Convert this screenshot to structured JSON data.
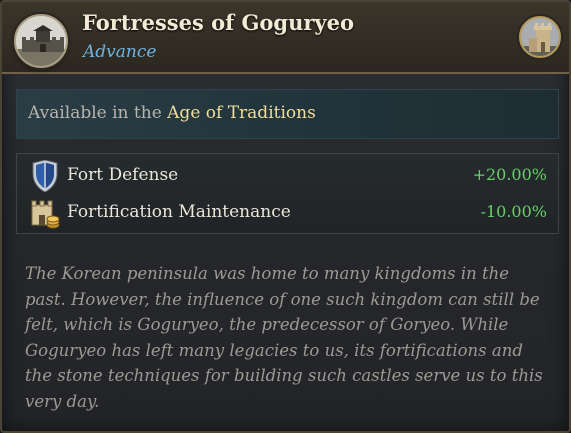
{
  "header": {
    "title": "Fortresses of Goguryeo",
    "subtitle": "Advance",
    "left_icon": "fortress-wall-icon",
    "right_icon": "stone-tower-icon"
  },
  "availability": {
    "prefix": "Available in the ",
    "age": "Age of Traditions"
  },
  "effects": [
    {
      "icon": "shield-icon",
      "label": "Fort Defense",
      "value": "+20.00%"
    },
    {
      "icon": "fort-maintenance-icon",
      "label": "Fortification Maintenance",
      "value": "-10.00%"
    }
  ],
  "description": "The Korean peninsula was home to many kingdoms in the past. However, the influence of one such kingdom can still be felt, which is Goguryeo, the predecessor of Goryeo. While Goguryeo has left many legacies to us, its fortifications and the stone techniques for building such castles serve us to this very day.",
  "colors": {
    "title": "#f3ead5",
    "subtitle": "#6fb3e0",
    "age_highlight": "#f1dd9a",
    "positive_value": "#69cf69",
    "description": "#9d9a93"
  }
}
